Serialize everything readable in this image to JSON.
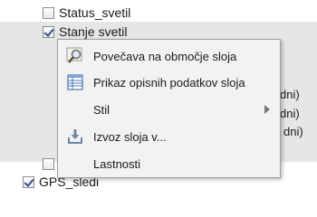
{
  "layers": [
    {
      "label": "Status_svetil",
      "checked": false
    },
    {
      "label": "Stanje svetil",
      "checked": true
    },
    {
      "label": "GPS_sledi",
      "checked": true
    }
  ],
  "obscured_fragments": [
    "dni)",
    "dni)",
    "dni)"
  ],
  "context_menu": {
    "items": [
      {
        "label": "Povečava na območje sloja",
        "icon": "zoom-to-layer-icon"
      },
      {
        "label": "Prikaz opisnih podatkov sloja",
        "icon": "attribute-table-icon"
      },
      {
        "label": "Stil",
        "icon": "",
        "has_submenu": true
      },
      {
        "label": "Izvoz sloja v...",
        "icon": "export-layer-icon"
      },
      {
        "label": "Lastnosti",
        "icon": ""
      }
    ]
  }
}
